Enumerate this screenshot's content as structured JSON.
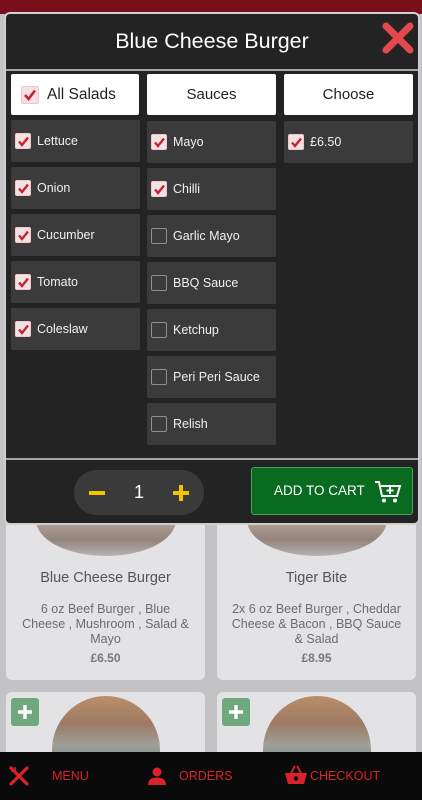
{
  "modal": {
    "title": "Blue Cheese Burger",
    "headers": {
      "salads": "All Salads",
      "sauces": "Sauces",
      "choose": "Choose"
    },
    "salads": [
      {
        "label": "Lettuce",
        "checked": true
      },
      {
        "label": "Onion",
        "checked": true
      },
      {
        "label": "Cucumber",
        "checked": true
      },
      {
        "label": "Tomato",
        "checked": true
      },
      {
        "label": "Coleslaw",
        "checked": true
      }
    ],
    "sauces": [
      {
        "label": "Mayo",
        "checked": true
      },
      {
        "label": "Chilli",
        "checked": true
      },
      {
        "label": "Garlic Mayo",
        "checked": false
      },
      {
        "label": "BBQ Sauce",
        "checked": false
      },
      {
        "label": "Ketchup",
        "checked": false
      },
      {
        "label": "Peri Peri Sauce",
        "checked": false
      },
      {
        "label": "Relish",
        "checked": false
      }
    ],
    "choose": [
      {
        "label": "£6.50",
        "checked": true
      }
    ],
    "quantity": "1",
    "add_to_cart_label": "ADD TO CART"
  },
  "menu_cards": [
    {
      "title": "Blue Cheese Burger",
      "description": "6 oz Beef Burger , Blue Cheese , Mushroom , Salad & Mayo",
      "price": "£6.50"
    },
    {
      "title": "Tiger Bite",
      "description": "2x 6 oz Beef Burger , Cheddar Cheese & Bacon , BBQ Sauce & Salad",
      "price": "£8.95"
    }
  ],
  "nav": {
    "menu": "MENU",
    "orders": "ORDERS",
    "checkout": "CHECKOUT"
  },
  "colors": {
    "accent_red": "#d8232a",
    "checkbox_red": "#c8242c",
    "add_green": "#096b1f",
    "qty_yellow": "#f5c400"
  },
  "icons": {
    "close": "close-x-icon",
    "cart": "cart-plus-icon",
    "menu": "fork-knife-icon",
    "orders": "user-icon",
    "checkout": "basket-icon"
  }
}
